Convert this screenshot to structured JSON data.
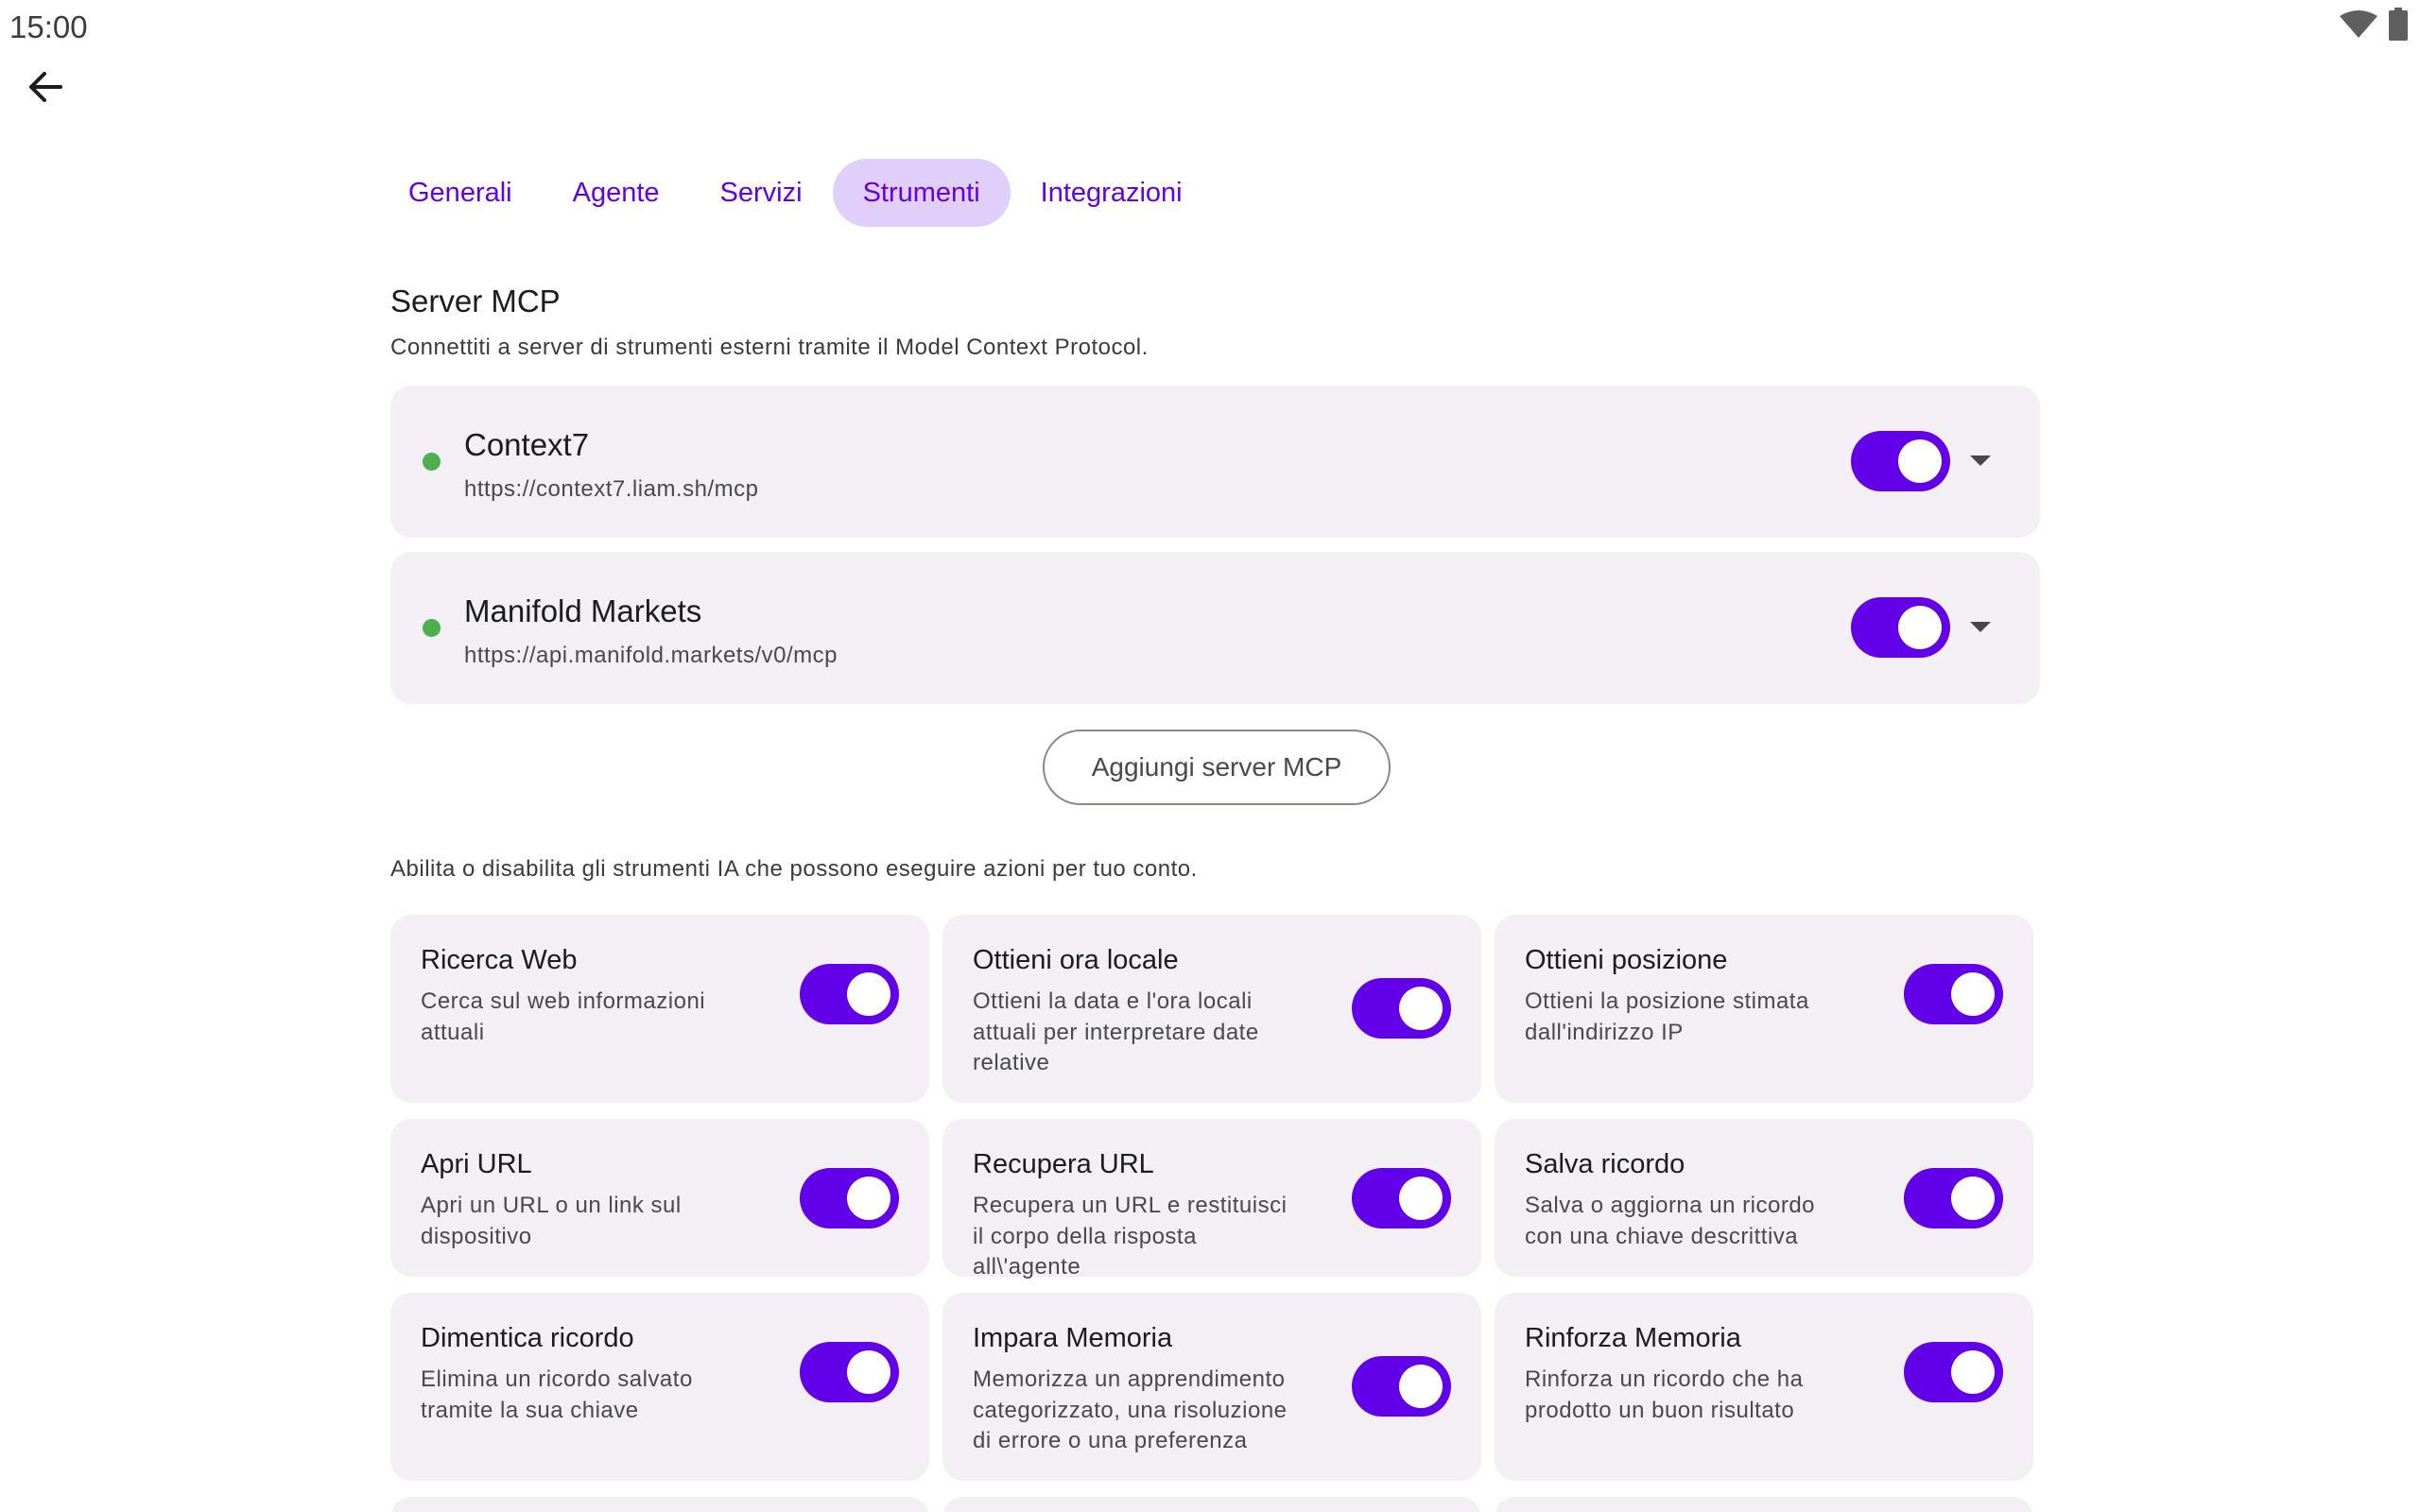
{
  "status_bar": {
    "time": "15:00",
    "wifi_icon": "wifi-icon",
    "battery_icon": "battery-icon"
  },
  "nav": {
    "back_icon": "arrow-back-icon"
  },
  "tabs": [
    {
      "label": "Generali",
      "active": false
    },
    {
      "label": "Agente",
      "active": false
    },
    {
      "label": "Servizi",
      "active": false
    },
    {
      "label": "Strumenti",
      "active": true
    },
    {
      "label": "Integrazioni",
      "active": false
    }
  ],
  "mcp": {
    "title": "Server MCP",
    "description": "Connettiti a server di strumenti esterni tramite il Model Context Protocol.",
    "servers": [
      {
        "name": "Context7",
        "url": "https://context7.liam.sh/mcp",
        "connected": true,
        "enabled": true
      },
      {
        "name": "Manifold Markets",
        "url": "https://api.manifold.markets/v0/mcp",
        "connected": true,
        "enabled": true
      }
    ],
    "add_button": "Aggiungi server MCP"
  },
  "tools": {
    "description": "Abilita o disabilita gli strumenti IA che possono eseguire azioni per tuo conto.",
    "items": [
      {
        "title": "Ricerca Web",
        "desc": "Cerca sul web informazioni attuali",
        "enabled": true
      },
      {
        "title": "Ottieni ora locale",
        "desc": "Ottieni la data e l'ora locali attuali per interpretare date relative",
        "enabled": true
      },
      {
        "title": "Ottieni posizione",
        "desc": "Ottieni la posizione stimata dall'indirizzo IP",
        "enabled": true
      },
      {
        "title": "Apri URL",
        "desc": "Apri un URL o un link sul dispositivo",
        "enabled": true
      },
      {
        "title": "Recupera URL",
        "desc": "Recupera un URL e restituisci il corpo della risposta all\\'agente",
        "enabled": true
      },
      {
        "title": "Salva ricordo",
        "desc": "Salva o aggiorna un ricordo con una chiave descrittiva",
        "enabled": true
      },
      {
        "title": "Dimentica ricordo",
        "desc": "Elimina un ricordo salvato tramite la sua chiave",
        "enabled": true
      },
      {
        "title": "Impara Memoria",
        "desc": "Memorizza un apprendimento categorizzato, una risoluzione di errore o una preferenza",
        "enabled": true
      },
      {
        "title": "Rinforza Memoria",
        "desc": "Rinforza un ricordo che ha prodotto un buon risultato",
        "enabled": true
      }
    ]
  },
  "colors": {
    "accent": "#6200ea",
    "tab_active_bg": "#e0cffa",
    "card_bg": "#f3eff4",
    "connected_dot": "#4caf50"
  }
}
